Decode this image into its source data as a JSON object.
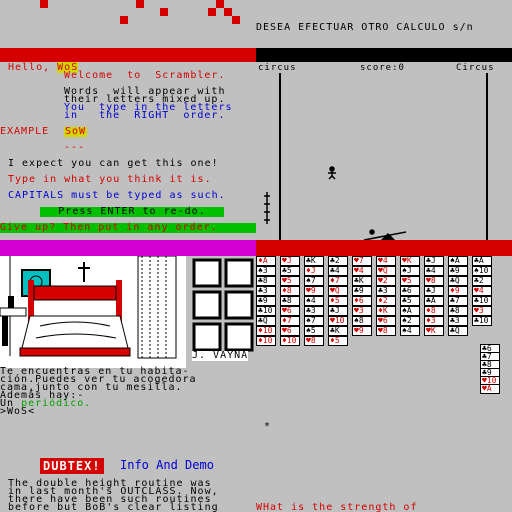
{
  "scrambler": {
    "greeting_prefix": "Hello,",
    "name": "WoS",
    "welcome": "Welcome  to  Scrambler.",
    "intro_lines": [
      "Words  will appear with",
      "their letters mixed up."
    ],
    "blue_lines": [
      "You  type in the letters",
      "in   the  RIGHT  order."
    ],
    "example_label": "EXAMPLE",
    "example_word": "SoW",
    "dashes": "---",
    "expect": "I expect you can get this one!",
    "type_hint": "Type in what you think it is.",
    "capitals": "CAPITALS must be typed as such.",
    "press_enter": "Press ENTER to re-do.",
    "give_up": "Give up? Then put in any order."
  },
  "circus": {
    "prompt": "DESEA EFECTUAR OTRO CALCULO s/n",
    "title_left": "circus",
    "score_label": "score:0",
    "title_right": "Circus",
    "balloon_rows": [
      {
        "color": "#0000ff"
      },
      {
        "color": "#d400d4"
      },
      {
        "color": "#d4d400"
      },
      {
        "color": "#00c000"
      }
    ]
  },
  "adventure": {
    "author": "J. VAYNA",
    "lines": [
      "Te encuentras en tu habita-",
      "ción.Puedes ver tu acogedora",
      "cama,junto con tu mesilla.",
      "Además hay:-"
    ],
    "item_prefix": "Un ",
    "item": "periódico.",
    "input": ">WoS<"
  },
  "cards": {
    "columns": [
      [
        {
          "t": "♦A",
          "c": "r"
        },
        {
          "t": "♠3",
          "c": "b"
        },
        {
          "t": "♣8",
          "c": "b"
        },
        {
          "t": "♣3",
          "c": "b"
        },
        {
          "t": "♣9",
          "c": "b"
        },
        {
          "t": "♣10",
          "c": "b"
        },
        {
          "t": "♣Q",
          "c": "b"
        },
        {
          "t": "♦10",
          "c": "r"
        },
        {
          "t": "♦10",
          "c": "r"
        }
      ],
      [
        {
          "t": "♥J",
          "c": "r"
        },
        {
          "t": "♣5",
          "c": "b"
        },
        {
          "t": "♥5",
          "c": "r"
        },
        {
          "t": "♦8",
          "c": "r"
        },
        {
          "t": "♣8",
          "c": "b"
        },
        {
          "t": "♥6",
          "c": "r"
        },
        {
          "t": "♦7",
          "c": "r"
        },
        {
          "t": "♥6",
          "c": "r"
        },
        {
          "t": "♦10",
          "c": "r"
        }
      ],
      [
        {
          "t": "♣K",
          "c": "b"
        },
        {
          "t": "♦J",
          "c": "r"
        },
        {
          "t": "♠7",
          "c": "b"
        },
        {
          "t": "♥9",
          "c": "r"
        },
        {
          "t": "♠4",
          "c": "b"
        },
        {
          "t": "♣3",
          "c": "b"
        },
        {
          "t": "♠7",
          "c": "b"
        },
        {
          "t": "♠5",
          "c": "b"
        },
        {
          "t": "♥8",
          "c": "r"
        }
      ],
      [
        {
          "t": "♣2",
          "c": "b"
        },
        {
          "t": "♣4",
          "c": "b"
        },
        {
          "t": "♦7",
          "c": "r"
        },
        {
          "t": "♥Q",
          "c": "r"
        },
        {
          "t": "♦5",
          "c": "r"
        },
        {
          "t": "♣J",
          "c": "b"
        },
        {
          "t": "♥10",
          "c": "r"
        },
        {
          "t": "♣K",
          "c": "b"
        },
        {
          "t": "♦5",
          "c": "r"
        }
      ],
      [
        {
          "t": "♥7",
          "c": "r"
        },
        {
          "t": "♥4",
          "c": "r"
        },
        {
          "t": "♣K",
          "c": "b"
        },
        {
          "t": "♣9",
          "c": "b"
        },
        {
          "t": "♦6",
          "c": "r"
        },
        {
          "t": "♥3",
          "c": "r"
        },
        {
          "t": "♠8",
          "c": "b"
        },
        {
          "t": "♥9",
          "c": "r"
        }
      ],
      [
        {
          "t": "♥4",
          "c": "r"
        },
        {
          "t": "♥Q",
          "c": "r"
        },
        {
          "t": "♥2",
          "c": "r"
        },
        {
          "t": "♣3",
          "c": "b"
        },
        {
          "t": "♦2",
          "c": "r"
        },
        {
          "t": "♦K",
          "c": "r"
        },
        {
          "t": "♥6",
          "c": "r"
        },
        {
          "t": "♥8",
          "c": "r"
        }
      ],
      [
        {
          "t": "♥K",
          "c": "r"
        },
        {
          "t": "♠J",
          "c": "b"
        },
        {
          "t": "♥5",
          "c": "r"
        },
        {
          "t": "♣6",
          "c": "b"
        },
        {
          "t": "♣5",
          "c": "b"
        },
        {
          "t": "♠A",
          "c": "b"
        },
        {
          "t": "♠2",
          "c": "b"
        },
        {
          "t": "♠4",
          "c": "b"
        }
      ],
      [
        {
          "t": "♣J",
          "c": "b"
        },
        {
          "t": "♣4",
          "c": "b"
        },
        {
          "t": "♥8",
          "c": "r"
        },
        {
          "t": "♣J",
          "c": "b"
        },
        {
          "t": "♣A",
          "c": "b"
        },
        {
          "t": "♦8",
          "c": "r"
        },
        {
          "t": "♦3",
          "c": "r"
        },
        {
          "t": "♥K",
          "c": "r"
        }
      ],
      [
        {
          "t": "♠A",
          "c": "b"
        },
        {
          "t": "♣9",
          "c": "b"
        },
        {
          "t": "♣Q",
          "c": "b"
        },
        {
          "t": "♦9",
          "c": "r"
        },
        {
          "t": "♣7",
          "c": "b"
        },
        {
          "t": "♣8",
          "c": "b"
        },
        {
          "t": "♣3",
          "c": "b"
        },
        {
          "t": "♣Q",
          "c": "b"
        }
      ],
      [
        {
          "t": "♣A",
          "c": "b"
        },
        {
          "t": "♠10",
          "c": "b"
        },
        {
          "t": "♣2",
          "c": "b"
        },
        {
          "t": "♥4",
          "c": "r"
        },
        {
          "t": "♣10",
          "c": "b"
        },
        {
          "t": "♥3",
          "c": "r"
        },
        {
          "t": "♣10",
          "c": "b"
        }
      ]
    ],
    "stack": [
      {
        "t": "♣6",
        "c": "b"
      },
      {
        "t": "♣7",
        "c": "b"
      },
      {
        "t": "♣8",
        "c": "b"
      },
      {
        "t": "♣9",
        "c": "b"
      },
      {
        "t": "♥10",
        "c": "r"
      },
      {
        "t": "♥A",
        "c": "r"
      }
    ]
  },
  "article": {
    "badge": "DUBTEX!",
    "heading": "Info And Demo",
    "lines": [
      "The double height routine was",
      "in last month's OUTCLASS. Now,",
      "there have been such routines",
      "before but BoB's clear listing"
    ]
  },
  "bottom_right": {
    "text": "WHat is the strength of"
  }
}
